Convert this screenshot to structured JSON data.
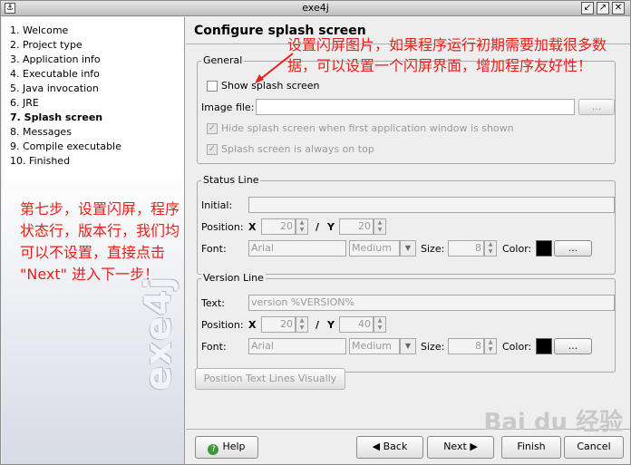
{
  "window": {
    "title": "exe4j"
  },
  "sidebar": {
    "steps": [
      "1. Welcome",
      "2. Project type",
      "3. Application info",
      "4. Executable info",
      "5. Java invocation",
      "6. JRE",
      "7. Splash screen",
      "8. Messages",
      "9. Compile executable",
      "10. Finished"
    ],
    "active_index": 6,
    "note": "第七步，设置闪屏，程序状态行，版本行，我们均可以不设置，直接点击 \"Next\" 进入下一步！",
    "brand": "exe4j"
  },
  "page": {
    "title": "Configure splash screen"
  },
  "annotation": "设置闪屏图片，如果程序运行初期需要加载很多数据，可以设置一个闪屏界面，增加程序友好性！",
  "general": {
    "legend": "General",
    "show_splash_label": "Show splash screen",
    "image_file_label": "Image file:",
    "image_file_value": "",
    "browse_label": "...",
    "hide_label": "Hide splash screen when first application window is shown",
    "ontop_label": "Splash screen is always on top"
  },
  "status": {
    "legend": "Status Line",
    "initial_label": "Initial:",
    "initial_value": "",
    "position_label": "Position:",
    "x_label": "X",
    "x_value": "20",
    "slash": "/",
    "y_label": "Y",
    "y_value": "20",
    "font_label": "Font:",
    "font_value": "Arial",
    "style_value": "Medium",
    "size_label": "Size:",
    "size_value": "8",
    "color_label": "Color:",
    "color_btn": "...",
    "color": "#000000"
  },
  "version": {
    "legend": "Version Line",
    "text_label": "Text:",
    "text_value": "version %VERSION%",
    "position_label": "Position:",
    "x_label": "X",
    "x_value": "20",
    "slash": "/",
    "y_label": "Y",
    "y_value": "40",
    "font_label": "Font:",
    "font_value": "Arial",
    "style_value": "Medium",
    "size_label": "Size:",
    "size_value": "8",
    "color_label": "Color:",
    "color_btn": "...",
    "color": "#000000"
  },
  "position_visually_label": "Position Text Lines Visually",
  "footer": {
    "help": "Help",
    "back": "Back",
    "next": "Next",
    "finish": "Finish",
    "cancel": "Cancel"
  },
  "watermark": "Bai du 经验"
}
